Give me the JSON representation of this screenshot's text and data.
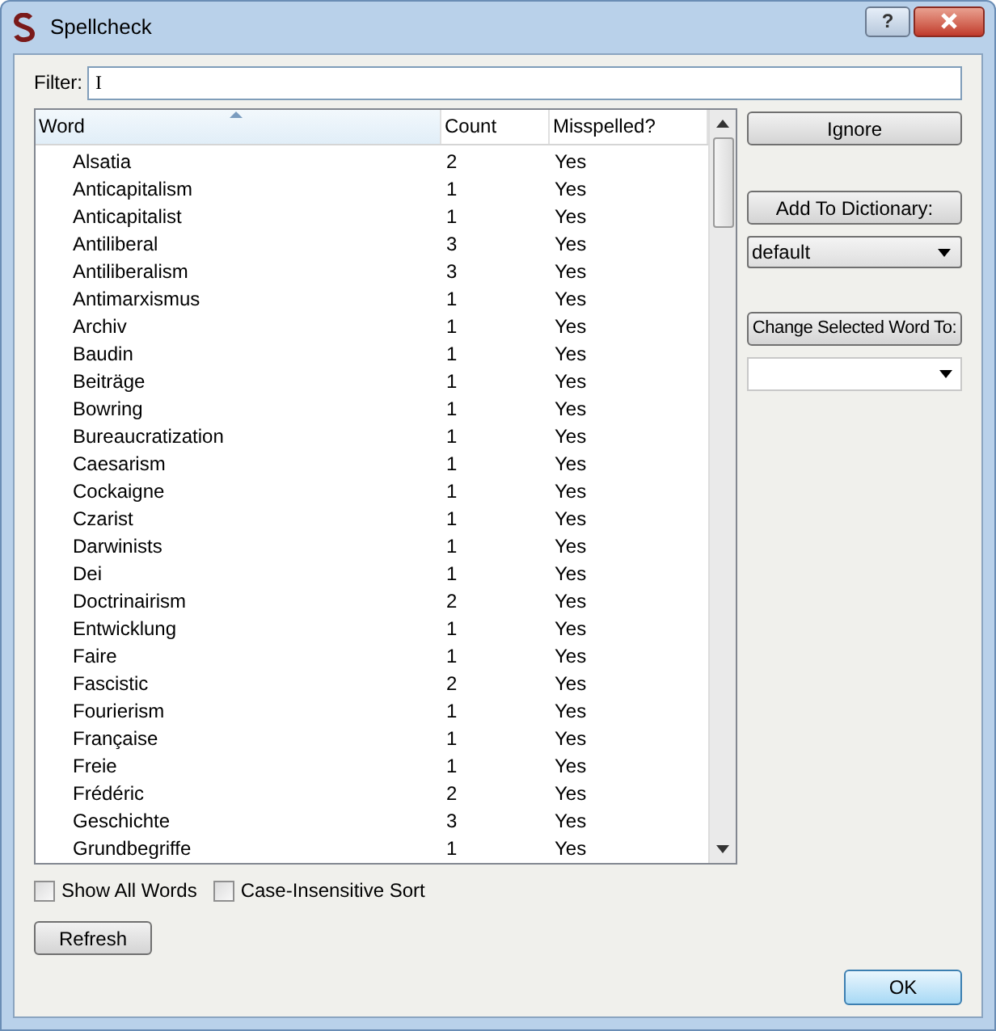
{
  "window": {
    "title": "Spellcheck",
    "buttons": [
      "?"
    ]
  },
  "filter": {
    "label": "Filter:",
    "value": "I"
  },
  "table": {
    "columns": [
      {
        "label": "Word",
        "sorted": true
      },
      {
        "label": "Count",
        "sorted": false
      },
      {
        "label": "Misspelled?",
        "sorted": false
      }
    ],
    "rows": [
      [
        "Alsatia",
        "2",
        "Yes"
      ],
      [
        "Anticapitalism",
        "1",
        "Yes"
      ],
      [
        "Anticapitalist",
        "1",
        "Yes"
      ],
      [
        "Antiliberal",
        "3",
        "Yes"
      ],
      [
        "Antiliberalism",
        "3",
        "Yes"
      ],
      [
        "Antimarxismus",
        "1",
        "Yes"
      ],
      [
        "Archiv",
        "1",
        "Yes"
      ],
      [
        "Baudin",
        "1",
        "Yes"
      ],
      [
        "Beiträge",
        "1",
        "Yes"
      ],
      [
        "Bowring",
        "1",
        "Yes"
      ],
      [
        "Bureaucratization",
        "1",
        "Yes"
      ],
      [
        "Caesarism",
        "1",
        "Yes"
      ],
      [
        "Cockaigne",
        "1",
        "Yes"
      ],
      [
        "Czarist",
        "1",
        "Yes"
      ],
      [
        "Darwinists",
        "1",
        "Yes"
      ],
      [
        "Dei",
        "1",
        "Yes"
      ],
      [
        "Doctrinairism",
        "2",
        "Yes"
      ],
      [
        "Entwicklung",
        "1",
        "Yes"
      ],
      [
        "Faire",
        "1",
        "Yes"
      ],
      [
        "Fascistic",
        "2",
        "Yes"
      ],
      [
        "Fourierism",
        "1",
        "Yes"
      ],
      [
        "Française",
        "1",
        "Yes"
      ],
      [
        "Freie",
        "1",
        "Yes"
      ],
      [
        "Frédéric",
        "2",
        "Yes"
      ],
      [
        "Geschichte",
        "3",
        "Yes"
      ],
      [
        "Grundbegriffe",
        "1",
        "Yes"
      ]
    ]
  },
  "ignore_button": "Ignore",
  "add_button": "Add To Dictionary:",
  "dictionary": {
    "value": "default"
  },
  "change_button": "Change Selected Word To:",
  "options": [
    {
      "label": "Show All Words",
      "checked": false
    },
    {
      "label": "Case-Insensitive Sort",
      "checked": false
    }
  ],
  "refresh_button": "Refresh",
  "ok_button": "OK"
}
